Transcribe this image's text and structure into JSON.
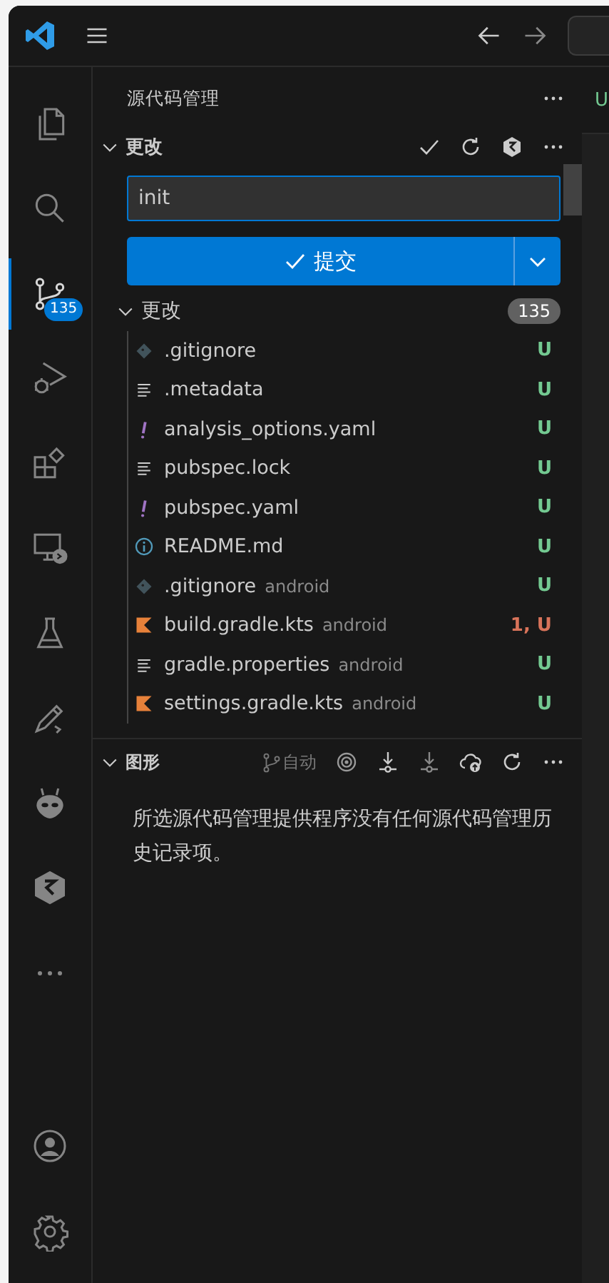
{
  "activity_bar": {
    "items": [
      {
        "kind": "explorer",
        "selected": false
      },
      {
        "kind": "search",
        "selected": false
      },
      {
        "kind": "scm",
        "selected": true,
        "badge": "135"
      },
      {
        "kind": "debug",
        "selected": false
      },
      {
        "kind": "extensions",
        "selected": false
      },
      {
        "kind": "remote",
        "selected": false
      },
      {
        "kind": "testing",
        "selected": false
      },
      {
        "kind": "pen",
        "selected": false
      },
      {
        "kind": "alien",
        "selected": false
      },
      {
        "kind": "hexagon",
        "selected": false
      },
      {
        "kind": "more",
        "selected": false
      }
    ],
    "bottom": [
      {
        "kind": "account"
      },
      {
        "kind": "settings"
      }
    ]
  },
  "sidebar": {
    "title": "源代码管理",
    "changes_section": {
      "title": "更改",
      "expanded": true,
      "message": "init",
      "commit_button": "提交"
    },
    "changes_group": {
      "title": "更改",
      "count": "135",
      "expanded": true,
      "files": [
        {
          "name": ".gitignore",
          "kind": "git",
          "status": "U",
          "color": "#73c991"
        },
        {
          "name": ".metadata",
          "kind": "lines",
          "status": "U",
          "color": "#73c991"
        },
        {
          "name": "analysis_options.yaml",
          "kind": "yaml",
          "status": "U",
          "color": "#73c991"
        },
        {
          "name": "pubspec.lock",
          "kind": "lines",
          "status": "U",
          "color": "#73c991"
        },
        {
          "name": "pubspec.yaml",
          "kind": "yaml",
          "status": "U",
          "color": "#73c991"
        },
        {
          "name": "README.md",
          "kind": "info",
          "status": "U",
          "color": "#73c991"
        },
        {
          "name": ".gitignore",
          "folder": "android",
          "kind": "git",
          "status": "U",
          "color": "#73c991"
        },
        {
          "name": "build.gradle.kts",
          "folder": "android",
          "kind": "kotlin",
          "status": "1, U",
          "color": "#d8735a"
        },
        {
          "name": "gradle.properties",
          "folder": "android",
          "kind": "lines",
          "status": "U",
          "color": "#73c991"
        },
        {
          "name": "settings.gradle.kts",
          "folder": "android",
          "kind": "kotlin",
          "status": "U",
          "color": "#73c991"
        }
      ]
    },
    "graph_section": {
      "title": "图形",
      "expanded": true,
      "branch": "自动",
      "message": "所选源代码管理提供程序没有任何源代码管理历史记录项。"
    }
  },
  "editor_fragment": "U"
}
